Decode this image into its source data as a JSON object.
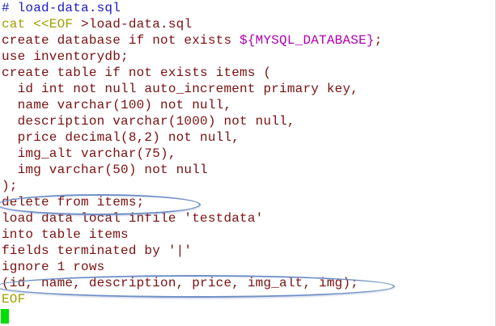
{
  "colors": {
    "comment": "#1b1bc9",
    "heredoc": "#a0a000",
    "variable": "#b000b0",
    "sql": "#7a1010",
    "highlight": "#6f8fc6",
    "cursor": "#00e000"
  },
  "lines": [
    [
      {
        "t": "# load-data.sql",
        "c": "comment"
      }
    ],
    [
      {
        "t": "cat <<EOF",
        "c": "heredoc"
      },
      {
        "t": " >load-data.sql",
        "c": "sql"
      }
    ],
    [
      {
        "t": "create database if not exists ",
        "c": "sql"
      },
      {
        "t": "${MYSQL_DATABASE}",
        "c": "variable"
      },
      {
        "t": ";",
        "c": "sql"
      }
    ],
    [
      {
        "t": "use inventorydb;",
        "c": "sql"
      }
    ],
    [
      {
        "t": "create table if not exists items (",
        "c": "sql"
      }
    ],
    [
      {
        "t": "  id int not null auto_increment primary key,",
        "c": "sql"
      }
    ],
    [
      {
        "t": "  name varchar(100) not null,",
        "c": "sql"
      }
    ],
    [
      {
        "t": "  description varchar(1000) not null,",
        "c": "sql"
      }
    ],
    [
      {
        "t": "  price decimal(8,2) not null,",
        "c": "sql"
      }
    ],
    [
      {
        "t": "  img_alt varchar(75),",
        "c": "sql"
      }
    ],
    [
      {
        "t": "  img varchar(50) not null",
        "c": "sql"
      }
    ],
    [
      {
        "t": ");",
        "c": "sql"
      }
    ],
    [
      {
        "t": "delete from items;",
        "c": "sql"
      }
    ],
    [
      {
        "t": "load data local infile 'testdata'",
        "c": "sql"
      }
    ],
    [
      {
        "t": "into table items",
        "c": "sql"
      }
    ],
    [
      {
        "t": "fields terminated by '|'",
        "c": "sql"
      }
    ],
    [
      {
        "t": "ignore 1 rows",
        "c": "sql"
      }
    ],
    [
      {
        "t": "(id, name, description, price, img_alt, img);",
        "c": "sql"
      }
    ],
    [
      {
        "t": "EOF",
        "c": "heredoc"
      }
    ]
  ]
}
